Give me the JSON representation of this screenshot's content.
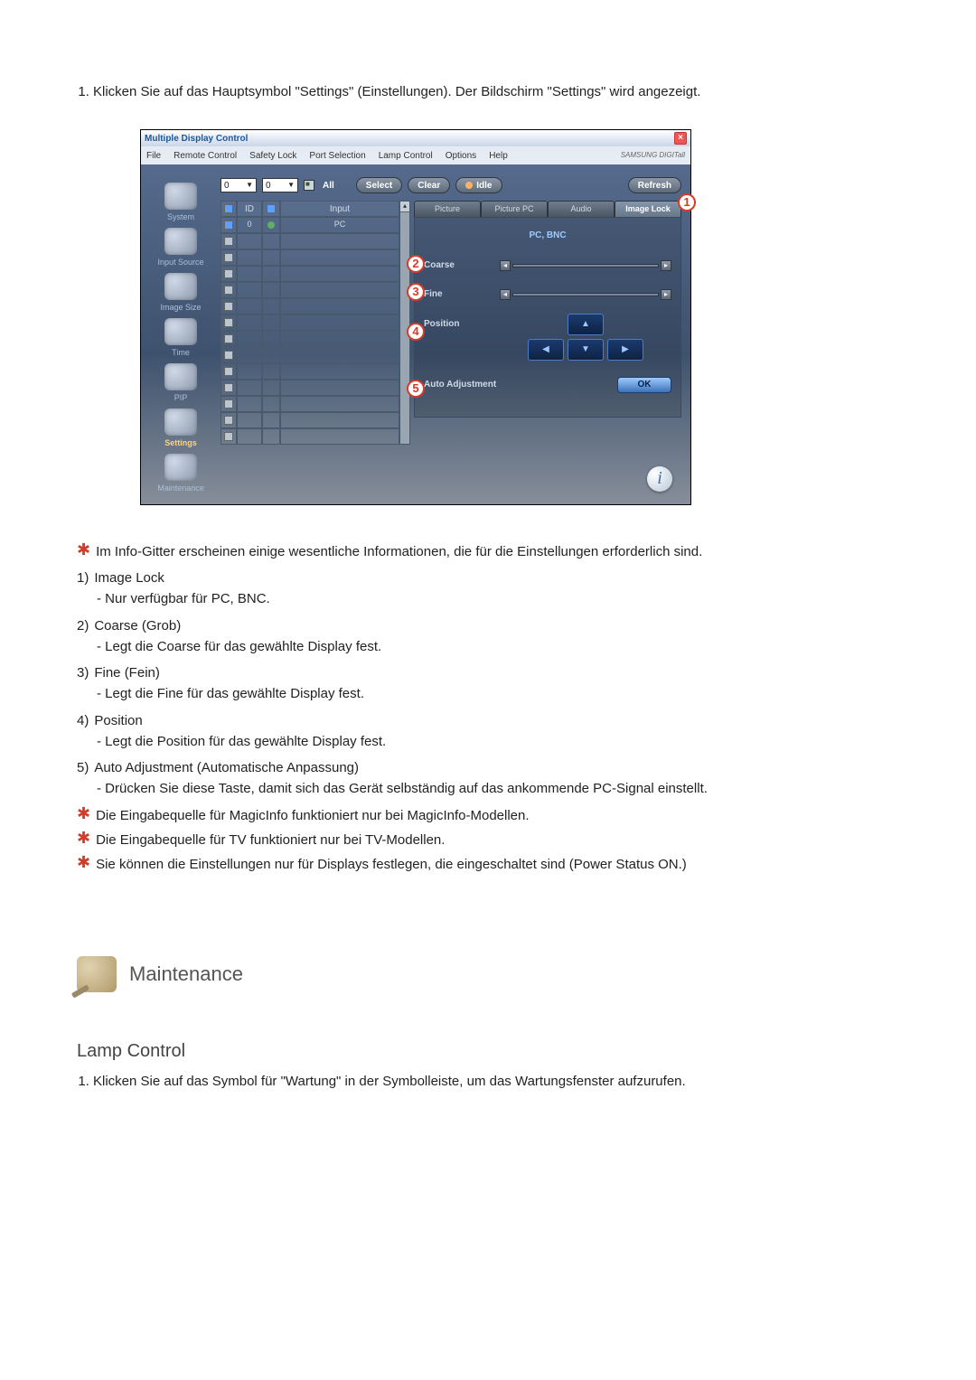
{
  "intro": {
    "item1": "Klicken Sie auf das Hauptsymbol \"Settings\" (Einstellungen). Der Bildschirm \"Settings\" wird angezeigt."
  },
  "app": {
    "title": "Multiple Display Control",
    "menus": [
      "File",
      "Remote Control",
      "Safety Lock",
      "Port Selection",
      "Lamp Control",
      "Options",
      "Help"
    ],
    "brand": "SAMSUNG DIGITall",
    "sidebar": [
      {
        "label": "System"
      },
      {
        "label": "Input Source"
      },
      {
        "label": "Image Size"
      },
      {
        "label": "Time"
      },
      {
        "label": "PIP"
      },
      {
        "label": "Settings"
      },
      {
        "label": "Maintenance"
      }
    ],
    "toprow": {
      "dd1": "0",
      "dd2": "0",
      "all": "All",
      "select": "Select",
      "clear": "Clear",
      "idle": "Idle",
      "refresh": "Refresh"
    },
    "grid": {
      "head": [
        "",
        "ID",
        "",
        "Input"
      ],
      "row0": {
        "id": "0",
        "input": "PC"
      }
    },
    "tabs": [
      "Picture",
      "Picture PC",
      "Audio",
      "Image Lock"
    ],
    "panel": {
      "heading": "PC, BNC",
      "coarse": "Coarse",
      "fine": "Fine",
      "position": "Position",
      "auto": "Auto Adjustment",
      "ok": "OK"
    }
  },
  "badges": {
    "b1": "1",
    "b2": "2",
    "b3": "3",
    "b4": "4",
    "b5": "5"
  },
  "notes": {
    "star1": "Im Info-Gitter erscheinen einige wesentliche Informationen, die für die Einstellungen erforderlich sind.",
    "items": [
      {
        "n": "1)",
        "t": "Image Lock",
        "s": "- Nur verfügbar für PC, BNC."
      },
      {
        "n": "2)",
        "t": "Coarse (Grob)",
        "s": "- Legt die Coarse für das gewählte Display fest."
      },
      {
        "n": "3)",
        "t": "Fine (Fein)",
        "s": "- Legt die Fine für das gewählte Display fest."
      },
      {
        "n": "4)",
        "t": "Position",
        "s": "- Legt die Position für das gewählte Display fest."
      },
      {
        "n": "5)",
        "t": "Auto Adjustment (Automatische Anpassung)",
        "s": "- Drücken Sie diese Taste, damit sich das Gerät selbständig auf das ankommende PC-Signal einstellt."
      }
    ],
    "star2": "Die Eingabequelle für MagicInfo funktioniert nur bei MagicInfo-Modellen.",
    "star3": "Die Eingabequelle für TV funktioniert nur bei TV-Modellen.",
    "star4": "Sie können die Einstellungen nur für Displays festlegen, die eingeschaltet sind (Power Status ON.)"
  },
  "section": {
    "title": "Maintenance",
    "sub": "Lamp Control",
    "sub_item1": "Klicken Sie auf das Symbol für \"Wartung\" in der Symbolleiste, um das Wartungsfenster aufzurufen."
  }
}
